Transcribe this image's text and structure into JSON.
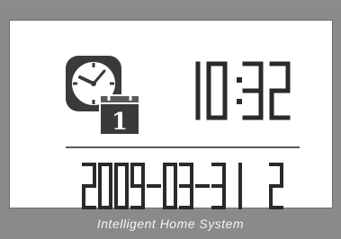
{
  "time": "10:32",
  "date": "2009-03-31",
  "weekday": "2",
  "calendar_day": "1",
  "footer": {
    "title": "Intelligent Home System"
  },
  "icons": {
    "clock": "clock-calendar-icon"
  },
  "colors": {
    "panel": "#8a8a8a",
    "screen": "#ffffff",
    "digits": "#2a2a2a",
    "icon": "#3a3a3a"
  }
}
